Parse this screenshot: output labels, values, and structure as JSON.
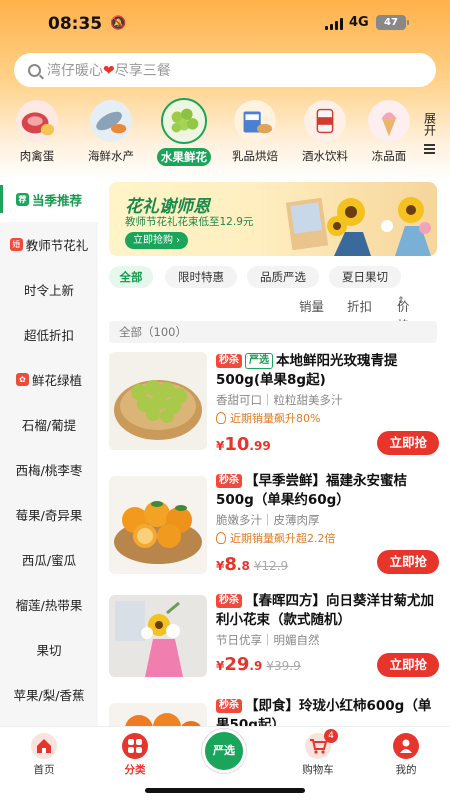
{
  "status": {
    "time": "08:35",
    "network": "4G",
    "battery": "47"
  },
  "search": {
    "placeholder_left": "湾仔暖心",
    "placeholder_right": "尽享三餐"
  },
  "categories": [
    {
      "label": "肉禽蛋",
      "icon": "meat-icon"
    },
    {
      "label": "海鲜水产",
      "icon": "seafood-icon"
    },
    {
      "label": "水果鲜花",
      "icon": "fruit-icon",
      "active": true
    },
    {
      "label": "乳品烘焙",
      "icon": "dairy-icon"
    },
    {
      "label": "酒水饮料",
      "icon": "drinks-icon"
    },
    {
      "label": "冻品面",
      "icon": "frozen-icon"
    }
  ],
  "expand_label": "展开",
  "sidebar": {
    "items": [
      {
        "label": "当季推荐",
        "tag": "荐"
      },
      {
        "label": "教师节花礼",
        "tag": "婚"
      },
      {
        "label": "时令上新"
      },
      {
        "label": "超低折扣"
      },
      {
        "label": "鲜花绿植",
        "tag": "✿"
      },
      {
        "label": "石榴/葡提"
      },
      {
        "label": "西梅/桃李枣"
      },
      {
        "label": "莓果/奇异果"
      },
      {
        "label": "西瓜/蜜瓜"
      },
      {
        "label": "榴莲/热带果"
      },
      {
        "label": "果切"
      },
      {
        "label": "苹果/梨/香蕉"
      }
    ]
  },
  "banner": {
    "title": "花礼谢师恩",
    "subtitle": "教师节花礼花束低至12.9元",
    "button": "立即抢购 ›"
  },
  "filters": [
    "全部",
    "限时特惠",
    "品质严选",
    "夏日果切"
  ],
  "sorts": {
    "sales": "销量",
    "discount": "折扣",
    "price": "价格"
  },
  "count_label": "全部（100）",
  "products": [
    {
      "badges": [
        "秒杀",
        "严选"
      ],
      "title": "本地鲜阳光玫瑰青提500g(单果8g起)",
      "subtitle": "香甜可口｜粒粒甜美多汁",
      "hot": "近期销量飙升80%",
      "price_int": "10",
      "price_dec": ".99",
      "orig": "",
      "buy": "立即抢"
    },
    {
      "badges": [
        "秒杀"
      ],
      "title": "【早季尝鲜】福建永安蜜桔500g（单果约60g）",
      "subtitle": "脆嫩多汁｜皮薄肉厚",
      "hot": "近期销量飙升超2.2倍",
      "price_int": "8",
      "price_dec": ".8",
      "orig": "¥12.9",
      "buy": "立即抢"
    },
    {
      "badges": [
        "秒杀"
      ],
      "title": "【春晖四方】向日葵洋甘菊尤加利小花束（款式随机）",
      "subtitle": "节日优享｜明媚自然",
      "hot": "",
      "price_int": "29",
      "price_dec": ".9",
      "orig": "¥39.9",
      "buy": "立即抢"
    },
    {
      "badges": [
        "秒杀"
      ],
      "title": "【即食】玲珑小红柿600g（单果50g起）",
      "subtitle": "",
      "hot": "",
      "price_int": "",
      "price_dec": "",
      "orig": "",
      "buy": ""
    }
  ],
  "tabs": [
    {
      "label": "首页",
      "icon": "home-icon"
    },
    {
      "label": "分类",
      "icon": "category-icon",
      "active": true
    },
    {
      "label": "严选",
      "icon": "strict-select-icon"
    },
    {
      "label": "购物车",
      "icon": "cart-icon",
      "badge": "4"
    },
    {
      "label": "我的",
      "icon": "profile-icon"
    }
  ],
  "colors": {
    "accent_green": "#1aa55a",
    "accent_red": "#e8352b",
    "hot_orange": "#e07b1e"
  }
}
